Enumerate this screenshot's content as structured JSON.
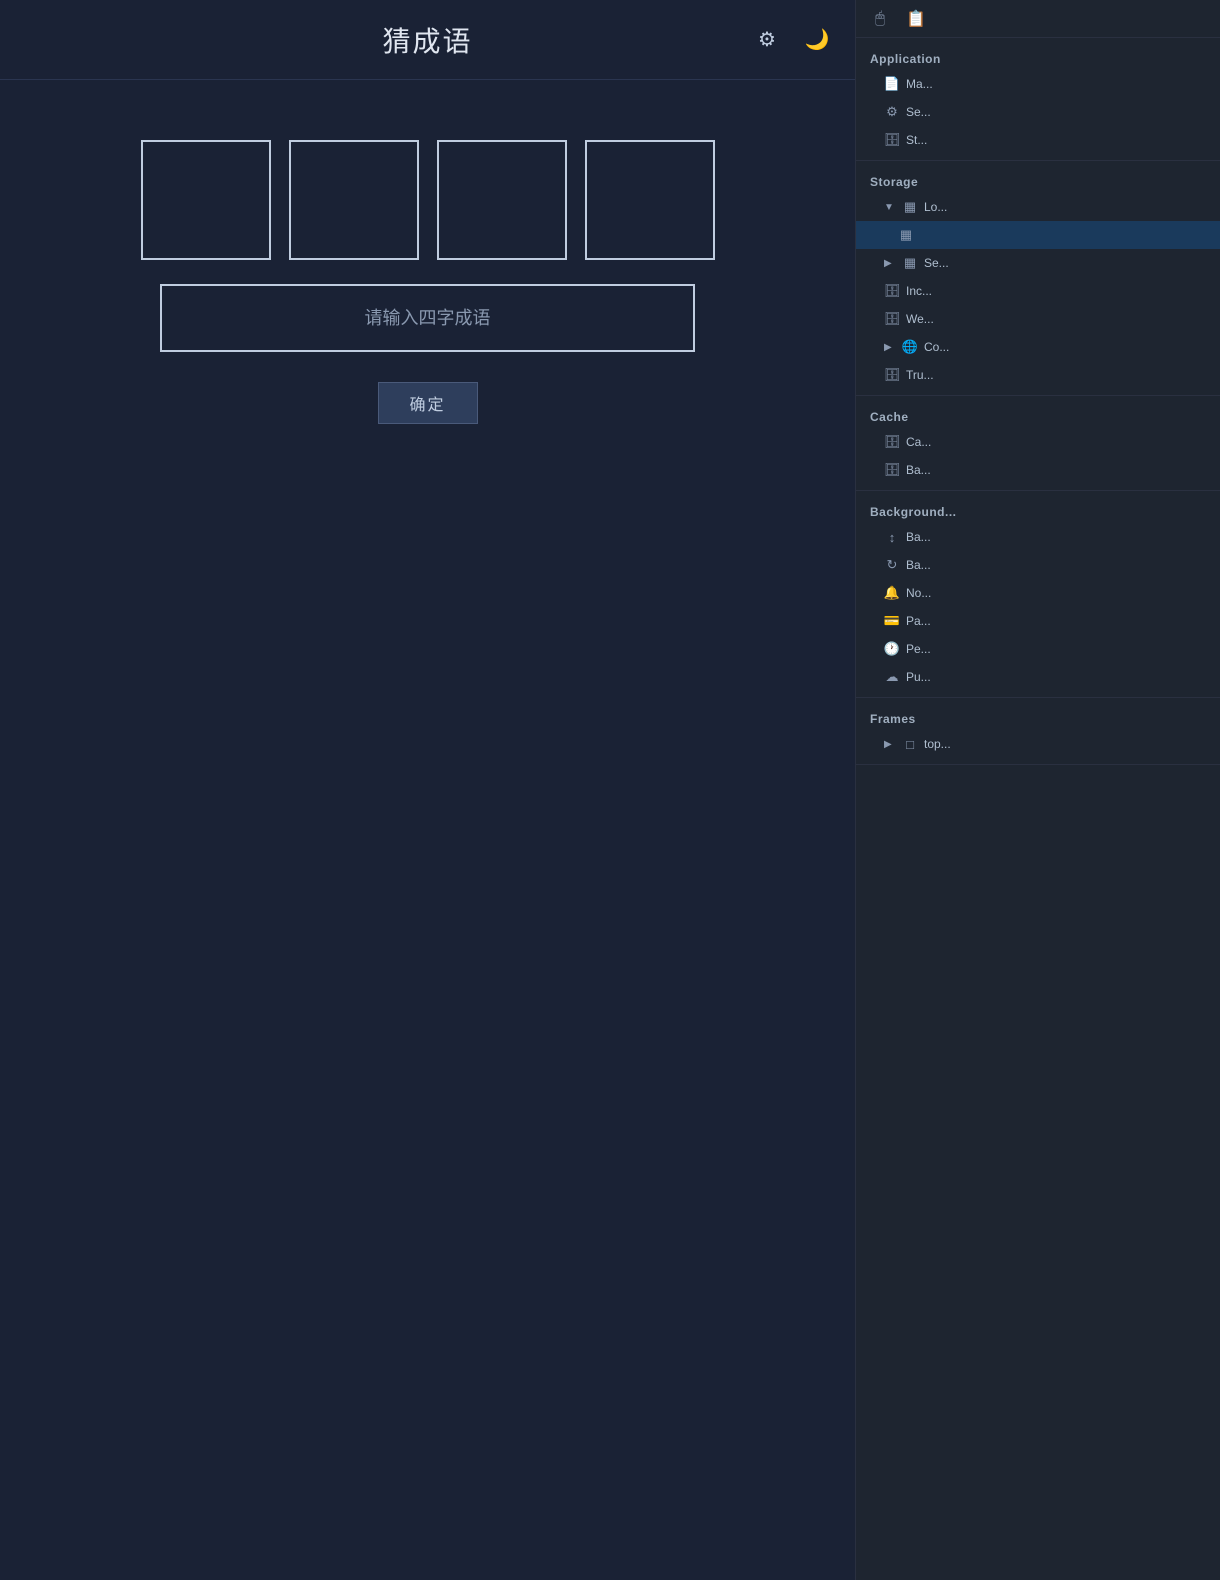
{
  "app": {
    "title": "猜成语",
    "header_icons": {
      "gear": "⚙",
      "moon": "🌙"
    },
    "input_placeholder": "请输入四字成语",
    "confirm_button": "确定",
    "char_boxes": [
      "",
      "",
      "",
      ""
    ]
  },
  "devtools": {
    "top_icons": [
      "🖱",
      "📋"
    ],
    "sections": {
      "application": {
        "title": "Application",
        "items": [
          {
            "icon": "📄",
            "text": "Ma...",
            "indent": 1,
            "expandable": false
          },
          {
            "icon": "⚙",
            "text": "Se...",
            "indent": 1,
            "expandable": false
          },
          {
            "icon": "🗄",
            "text": "St...",
            "indent": 1,
            "expandable": false
          }
        ]
      },
      "storage": {
        "title": "Storage",
        "items": [
          {
            "icon": "▦",
            "text": "Lo...",
            "indent": 1,
            "expandable": true,
            "expanded": true
          },
          {
            "icon": "▦",
            "text": "",
            "indent": 2,
            "expandable": false,
            "active": true
          },
          {
            "icon": "▦",
            "text": "Se...",
            "indent": 1,
            "expandable": true,
            "expanded": false
          },
          {
            "icon": "🗄",
            "text": "Inc...",
            "indent": 1,
            "expandable": false
          },
          {
            "icon": "🗄",
            "text": "We...",
            "indent": 1,
            "expandable": false
          },
          {
            "icon": "🌐",
            "text": "Co...",
            "indent": 1,
            "expandable": true,
            "expanded": false
          },
          {
            "icon": "🗄",
            "text": "Tru...",
            "indent": 1,
            "expandable": false
          }
        ]
      },
      "cache": {
        "title": "Cache",
        "items": [
          {
            "icon": "🗄",
            "text": "Ca...",
            "indent": 1,
            "expandable": false
          },
          {
            "icon": "🗄",
            "text": "Ba...",
            "indent": 1,
            "expandable": false
          }
        ]
      },
      "background": {
        "title": "Background...",
        "items": [
          {
            "icon": "↕",
            "text": "Ba...",
            "indent": 1,
            "expandable": false
          },
          {
            "icon": "↻",
            "text": "Ba...",
            "indent": 1,
            "expandable": false
          },
          {
            "icon": "🔔",
            "text": "No...",
            "indent": 1,
            "expandable": false
          },
          {
            "icon": "💳",
            "text": "Pa...",
            "indent": 1,
            "expandable": false
          },
          {
            "icon": "🕐",
            "text": "Pe...",
            "indent": 1,
            "expandable": false
          },
          {
            "icon": "☁",
            "text": "Pu...",
            "indent": 1,
            "expandable": false
          }
        ]
      },
      "frames": {
        "title": "Frames",
        "items": [
          {
            "icon": "□",
            "text": "top...",
            "indent": 1,
            "expandable": true,
            "expanded": false
          }
        ]
      }
    }
  }
}
